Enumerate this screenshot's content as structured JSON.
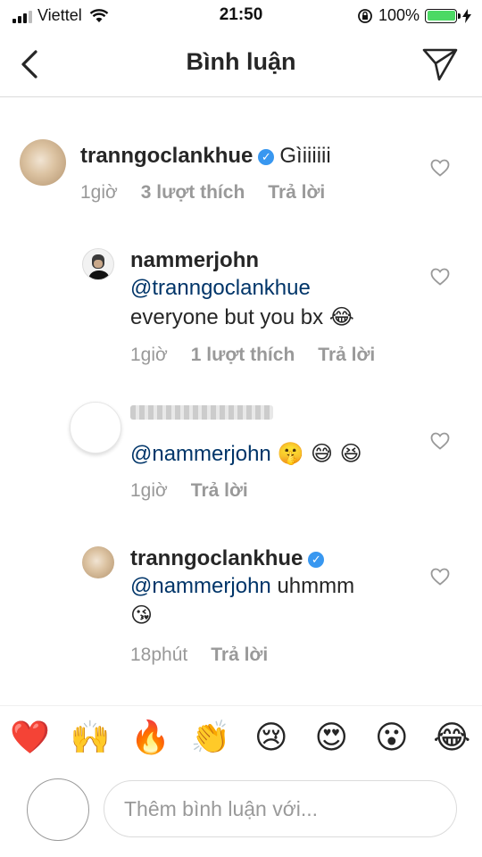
{
  "status_bar": {
    "carrier": "Viettel",
    "time": "21:50",
    "battery": "100%"
  },
  "header": {
    "title": "Bình luận"
  },
  "comments": [
    {
      "username": "tranngoclankhue",
      "verified": true,
      "text": "Gìiiiiii",
      "time": "1giờ",
      "likes": "3 lượt thích",
      "reply": "Trả lời"
    },
    {
      "username": "nammerjohn",
      "mention": "@tranngoclankhue",
      "text": "everyone but you bx 😂",
      "time": "1giờ",
      "likes": "1 lượt thích",
      "reply": "Trả lời"
    },
    {
      "mention": "@nammerjohn",
      "text": "🤫 😅 😆",
      "time": "1giờ",
      "reply": "Trả lời"
    },
    {
      "username": "tranngoclankhue",
      "verified": true,
      "mention": "@nammerjohn",
      "text": "uhmmm",
      "text2": "😘",
      "time": "18phút",
      "reply": "Trả lời"
    }
  ],
  "reactions": [
    "❤️",
    "🙌",
    "🔥",
    "👏",
    "😢",
    "😍",
    "😮",
    "😂"
  ],
  "composer": {
    "placeholder": "Thêm bình luận với..."
  }
}
